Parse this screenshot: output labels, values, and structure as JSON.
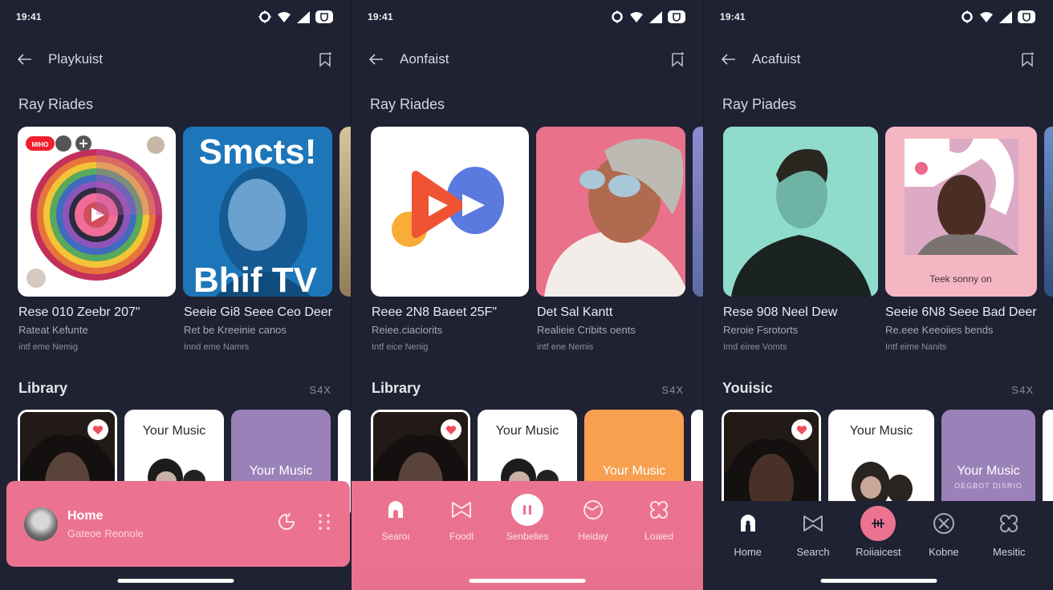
{
  "status_bar": {
    "time": "19:41"
  },
  "screens": [
    {
      "appbar_title": "Playkuist",
      "section1_title": "Ray Riades",
      "albums": [
        {
          "art": "rainbow-rings-play",
          "badge": "MIHO",
          "title": "Rese 010 Zeebr 207\"",
          "subtitle": "Rateat Kefunte",
          "meta": "intf eme Nemig"
        },
        {
          "art": "blue-poster-portrait",
          "poster_top": "Smcts!",
          "poster_bottom": "Bhif TV",
          "title": "Seeie Gi8 Seee Ceo Deer",
          "subtitle": "Ret be Kreeinie canos",
          "meta": "Innd eme Namrs"
        }
      ],
      "section2_title": "Library",
      "count": "S4X",
      "library": [
        {
          "kind": "portrait",
          "liked": true
        },
        {
          "kind": "white",
          "label": "Your Music"
        },
        {
          "kind": "colored",
          "label": "Your Music",
          "color": "#9a82b8"
        }
      ],
      "miniplayer": {
        "title": "Home",
        "subtitle": "Gateoe Reonole"
      }
    },
    {
      "appbar_title": "Aonfaist",
      "section1_title": "Ray Riades",
      "albums": [
        {
          "art": "play-logo",
          "title": "Reee 2N8 Baeet 25F\"",
          "subtitle": "Reiee.ciaciorits",
          "meta": "Intf eice Nenig"
        },
        {
          "art": "pink-portrait-beret",
          "title": "Det Sal Kantt",
          "subtitle": "Realieie Cribits oents",
          "meta": "intf ene Nemis"
        }
      ],
      "section2_title": "Library",
      "count": "S4X",
      "library": [
        {
          "kind": "portrait",
          "liked": true
        },
        {
          "kind": "white",
          "label": "Your Music"
        },
        {
          "kind": "colored",
          "label": "Your Music",
          "color": "#f7a04f"
        }
      ],
      "nav": [
        {
          "label": "Searoı",
          "icon": "home-icon"
        },
        {
          "label": "Foodl",
          "icon": "bowtie-icon"
        },
        {
          "label": "Senbelies",
          "icon": "pause-icon",
          "active": true
        },
        {
          "label": "Heiday",
          "icon": "clock-icon"
        },
        {
          "label": "Loaied",
          "icon": "clover-icon"
        }
      ]
    },
    {
      "appbar_title": "Acafuist",
      "section1_title": "Ray Piades",
      "albums": [
        {
          "art": "teal-portrait",
          "title": "Rese 908 Neel Dew",
          "subtitle": "Reroie Fsrotorts",
          "meta": "Imd eiree Vomts"
        },
        {
          "art": "pink-portrait-shapes",
          "caption": "Teek sonny on",
          "title": "Seeie 6N8 Seee Bad Deer",
          "subtitle": "Re.eee Keeoiies bends",
          "meta": "Intf eime Nanits"
        }
      ],
      "section2_title": "Youisic",
      "count": "S4X",
      "library": [
        {
          "kind": "portrait",
          "liked": true
        },
        {
          "kind": "white",
          "label": "Your Music"
        },
        {
          "kind": "colored",
          "label": "Your Music",
          "sublabel": "OEGBOT DISRIO",
          "color": "#9a82b8"
        }
      ],
      "nav": [
        {
          "label": "Home",
          "icon": "home-icon",
          "active_style": "white"
        },
        {
          "label": "Search",
          "icon": "bowtie-icon"
        },
        {
          "label": "Roiiaicest",
          "icon": "waveform-icon",
          "active": true
        },
        {
          "label": "Kobne",
          "icon": "close-circle-icon"
        },
        {
          "label": "Mesitic",
          "icon": "clover-icon"
        }
      ]
    }
  ],
  "colors": {
    "background": "#1f2233",
    "accent_pink": "#ec7390",
    "heart_red": "#f04e5e"
  }
}
